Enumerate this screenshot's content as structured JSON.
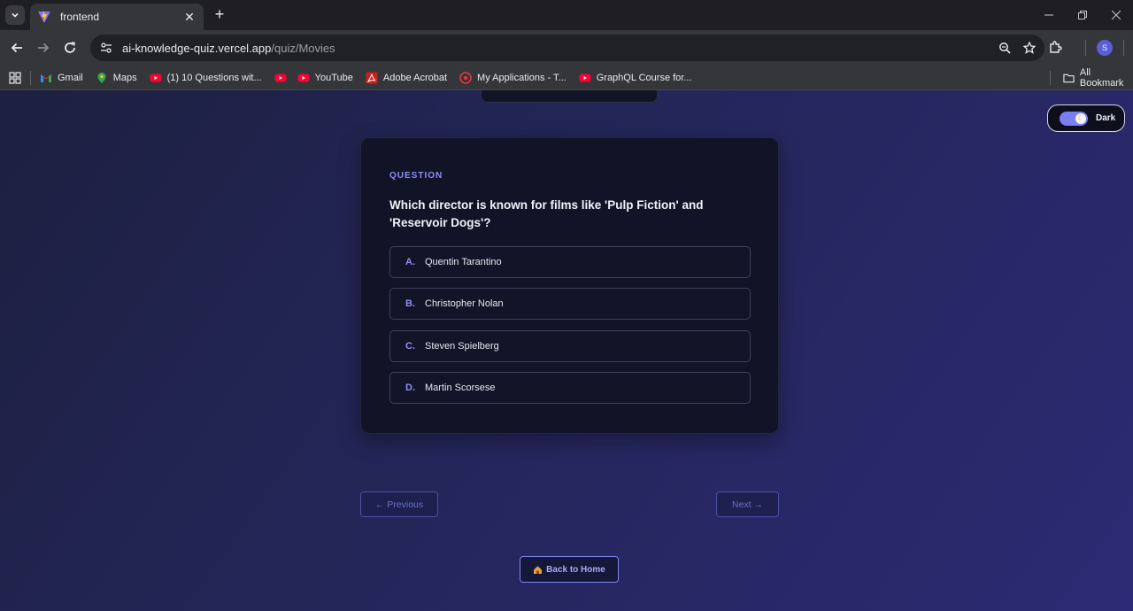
{
  "browser": {
    "tab_title": "frontend",
    "url_host": "ai-knowledge-quiz.vercel.app",
    "url_path": "/quiz/Movies",
    "profile_initial": "S",
    "bookmarks": [
      {
        "label": "Gmail",
        "icon": "gmail-icon"
      },
      {
        "label": "Maps",
        "icon": "maps-icon"
      },
      {
        "label": "(1) 10 Questions wit...",
        "icon": "youtube-icon"
      },
      {
        "label": "",
        "icon": "youtube-icon"
      },
      {
        "label": "YouTube",
        "icon": "youtube-icon"
      },
      {
        "label": "Adobe Acrobat",
        "icon": "acrobat-icon"
      },
      {
        "label": "My Applications - T...",
        "icon": "applications-icon"
      },
      {
        "label": "GraphQL Course for...",
        "icon": "youtube-icon"
      }
    ],
    "all_bookmarks_label": "All Bookmark"
  },
  "theme_toggle": {
    "label": "Dark",
    "on": true
  },
  "quiz": {
    "section_label": "QUESTION",
    "question": "Which director is known for films like 'Pulp Fiction' and 'Reservoir Dogs'?",
    "options": [
      {
        "letter": "A.",
        "text": "Quentin Tarantino"
      },
      {
        "letter": "B.",
        "text": "Christopher Nolan"
      },
      {
        "letter": "C.",
        "text": "Steven Spielberg"
      },
      {
        "letter": "D.",
        "text": "Martin Scorsese"
      }
    ],
    "prev_label": "← Previous",
    "next_label": "Next →",
    "home_label": "Back to Home",
    "home_icon": "house-icon"
  },
  "colors": {
    "accent": "#8c8ff7",
    "card_bg": "#111427",
    "page_gradient_start": "#1d2040",
    "page_gradient_end": "#2c2a74"
  }
}
